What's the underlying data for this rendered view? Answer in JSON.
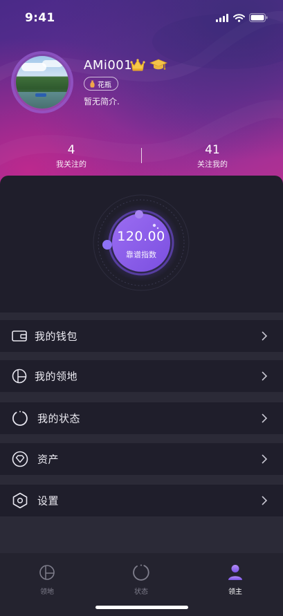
{
  "status_bar": {
    "time": "9:41"
  },
  "profile": {
    "username": "AMi001",
    "tag": "花瓶",
    "intro": "暂无简介.",
    "badges": [
      "crown-icon",
      "graduation-cap-icon"
    ]
  },
  "stats": [
    {
      "value": "4",
      "label": "我关注的"
    },
    {
      "value": "41",
      "label": "关注我的"
    }
  ],
  "reliability": {
    "value": "120.00",
    "label": "靠谱指数"
  },
  "menu": [
    {
      "label": "我的钱包",
      "icon": "wallet-icon"
    },
    {
      "label": "我的领地",
      "icon": "territory-icon"
    },
    {
      "label": "我的状态",
      "icon": "status-ring-icon"
    },
    {
      "label": "资产",
      "icon": "diamond-icon"
    },
    {
      "label": "设置",
      "icon": "settings-hexagon-icon"
    }
  ],
  "tabs": [
    {
      "label": "领地",
      "icon": "territory-icon",
      "active": false
    },
    {
      "label": "状态",
      "icon": "status-ring-icon",
      "active": false
    },
    {
      "label": "领主",
      "icon": "user-icon",
      "active": true
    }
  ],
  "colors": {
    "accent": "#8a63f0",
    "tab_active": "#ffffff",
    "tab_inactive": "#7f7e8c",
    "card_bg": "#1f1e2b",
    "separator": "#2b2a37"
  }
}
